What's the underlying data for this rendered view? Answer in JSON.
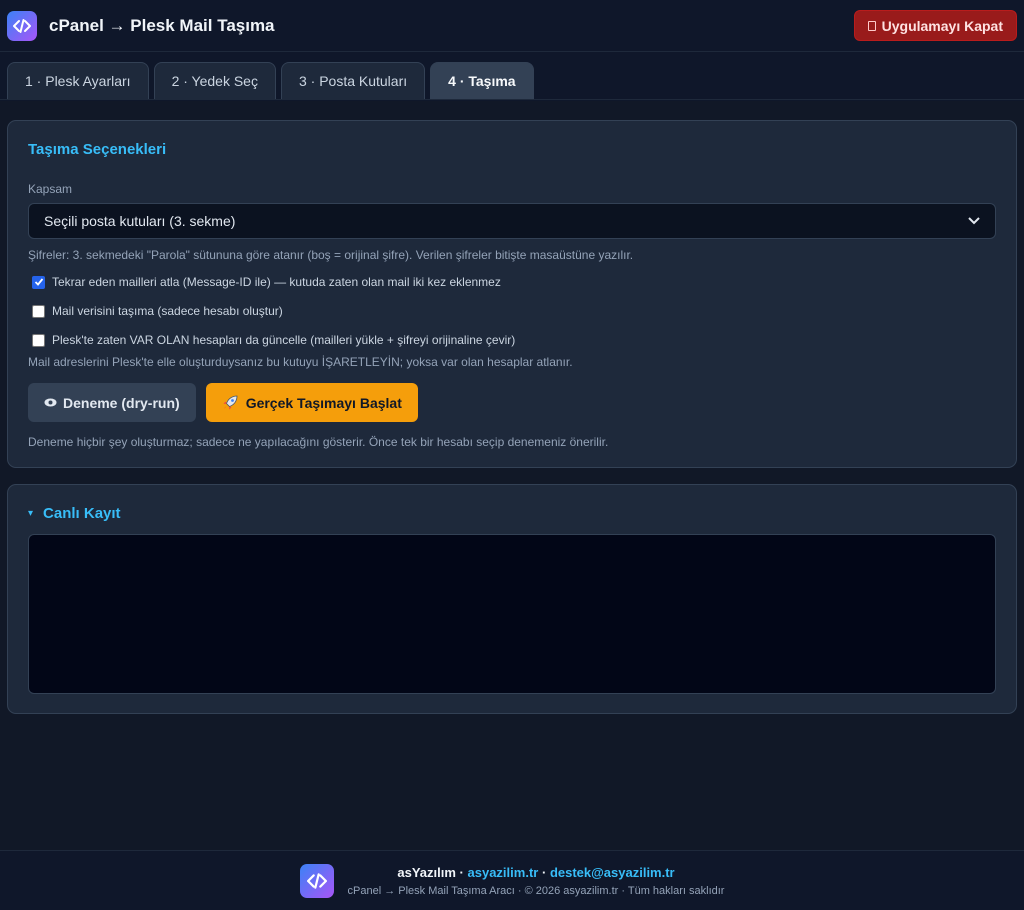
{
  "header": {
    "title": "cPanel → Plesk Mail Taşıma",
    "close_button": "Uygulamayı Kapat"
  },
  "tabs": [
    {
      "label": "1 · Plesk Ayarları"
    },
    {
      "label": "2 · Yedek Seç"
    },
    {
      "label": "3 · Posta Kutuları"
    },
    {
      "label": "4 · Taşıma",
      "active": true
    }
  ],
  "options": {
    "title": "Taşıma Seçenekleri",
    "scope_label": "Kapsam",
    "scope_value": "Seçili posta kutuları (3. sekme)",
    "password_hint": "Şifreler: 3. sekmedeki \"Parola\" sütununa göre atanır (boş = orijinal şifre). Verilen şifreler bitişte masaüstüne yazılır.",
    "checks": [
      {
        "label": "Tekrar eden mailleri atla (Message-ID ile) — kutuda zaten olan mail iki kez eklenmez",
        "checked": true
      },
      {
        "label": "Mail verisini taşıma (sadece hesabı oluştur)",
        "checked": false
      },
      {
        "label": "Plesk'te zaten VAR OLAN hesapları da güncelle (mailleri yükle + şifreyi orijinaline çevir)",
        "checked": false
      }
    ],
    "existing_hint": "Mail adreslerini Plesk'te elle oluşturduysanız bu kutuyu İŞARETLEYİN; yoksa var olan hesaplar atlanır.",
    "dry_run_button": "Deneme (dry-run)",
    "start_button": "Gerçek Taşımayı Başlat",
    "dry_run_hint": "Deneme hiçbir şey oluşturmaz; sadece ne yapılacağını gösterir. Önce tek bir hesabı seçip denemeniz önerilir."
  },
  "log": {
    "title": "Canlı Kayıt"
  },
  "footer": {
    "brand": "asYazılım",
    "separator": "·",
    "website": "asyazilim.tr",
    "email": "destek@asyazilim.tr",
    "copyright": "cPanel → Plesk Mail Taşıma Aracı · © 2026 asyazilim.tr · Tüm hakları saklıdır"
  },
  "icons": {
    "logo": "code-brackets-icon",
    "dry_run": "eye-icon",
    "start": "rocket-icon",
    "select": "chevron-down-icon",
    "log_toggle": "caret-down-icon"
  },
  "colors": {
    "accent": "#38bdf8",
    "danger": "#991b1b",
    "warning": "#f59e0b"
  }
}
